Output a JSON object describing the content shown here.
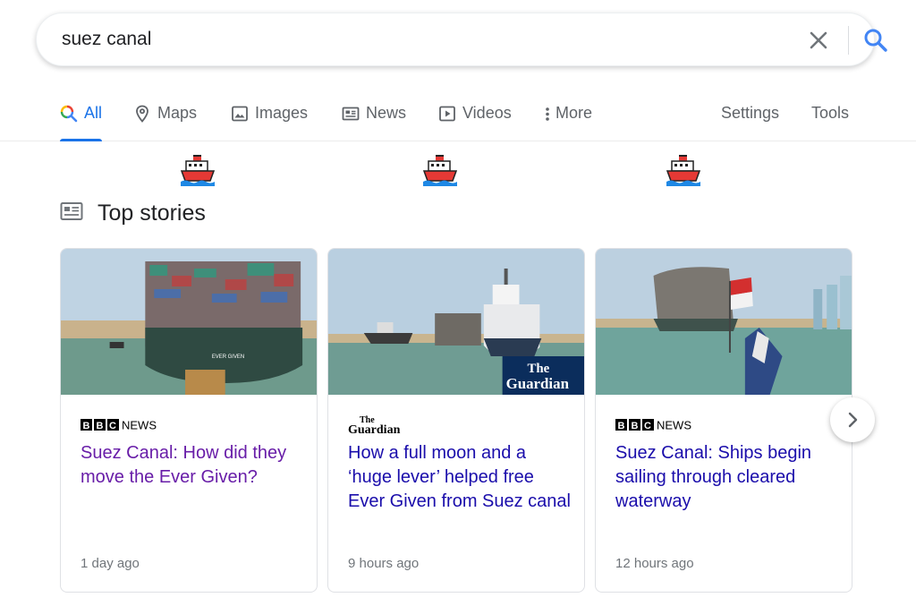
{
  "search": {
    "query": "suez canal"
  },
  "tabs": [
    {
      "label": "All",
      "icon": "search-icon",
      "active": true
    },
    {
      "label": "Maps",
      "icon": "map-pin-icon"
    },
    {
      "label": "Images",
      "icon": "image-icon"
    },
    {
      "label": "News",
      "icon": "newspaper-icon"
    },
    {
      "label": "Videos",
      "icon": "play-icon"
    },
    {
      "label": "More",
      "icon": "kebab-icon"
    }
  ],
  "tools": {
    "settings": "Settings",
    "tools": "Tools"
  },
  "decorations": {
    "ship_emoji_icon": "ship-icon"
  },
  "top_stories": {
    "title": "Top stories",
    "cards": [
      {
        "source": "BBC NEWS",
        "source_logo": "bbc-news-logo",
        "headline": "Suez Canal: How did they move the Ever Given?",
        "time": "1 day ago",
        "visited": true,
        "thumb_caption": "EVER GIVEN"
      },
      {
        "source": "The Guardian",
        "source_logo": "guardian-logo",
        "headline": "How a full moon and a ‘huge lever’ helped free Ever Given from Suez canal",
        "time": "9 hours ago",
        "visited": false
      },
      {
        "source": "BBC NEWS",
        "source_logo": "bbc-news-logo",
        "headline": "Suez Canal: Ships begin sailing through cleared waterway",
        "time": "12 hours ago",
        "visited": false
      }
    ]
  },
  "colors": {
    "accent": "#1a73e8",
    "link": "#1a0dab",
    "visited": "#681da8"
  }
}
